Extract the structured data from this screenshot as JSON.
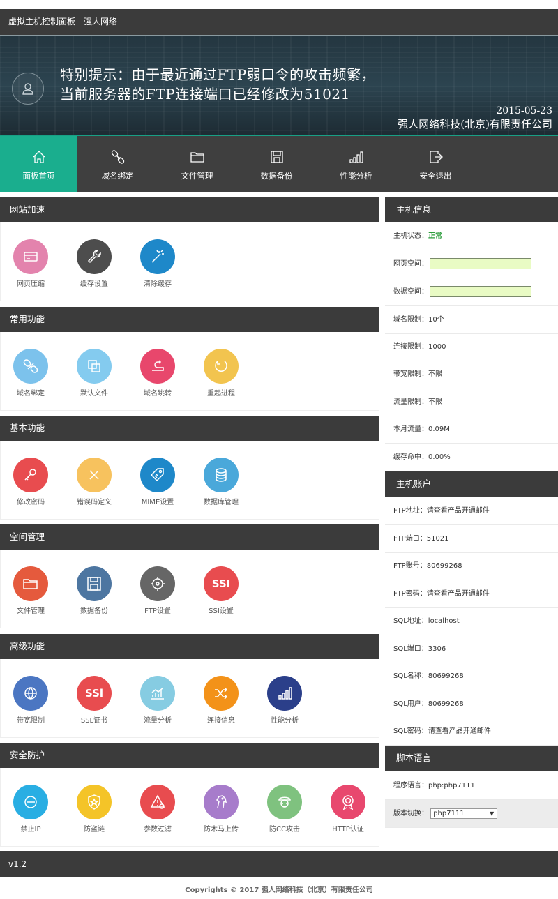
{
  "app": {
    "title": "虚拟主机控制面板 - 强人网络"
  },
  "banner": {
    "line1": "特别提示：由于最近通过FTP弱口令的攻击频繁，",
    "line2": "当前服务器的FTP连接端口已经修改为51021",
    "date": "2015-05-23",
    "company": "强人网络科技(北京)有限责任公司"
  },
  "nav": [
    {
      "label": "面板首页",
      "icon": "home-icon"
    },
    {
      "label": "域名绑定",
      "icon": "link-icon"
    },
    {
      "label": "文件管理",
      "icon": "folder-icon"
    },
    {
      "label": "数据备份",
      "icon": "floppy-icon"
    },
    {
      "label": "性能分析",
      "icon": "signal-icon"
    },
    {
      "label": "安全退出",
      "icon": "logout-icon"
    }
  ],
  "sections": [
    {
      "title": "网站加速",
      "items": [
        {
          "label": "网页压缩",
          "icon": "card-icon",
          "color": "#e383ad"
        },
        {
          "label": "缓存设置",
          "icon": "wrench-icon",
          "color": "#4d4d4d"
        },
        {
          "label": "清除缓存",
          "icon": "magic-wand-icon",
          "color": "#1e88c9"
        }
      ]
    },
    {
      "title": "常用功能",
      "items": [
        {
          "label": "域名绑定",
          "icon": "link-icon",
          "color": "#7cc2ec"
        },
        {
          "label": "默认文件",
          "icon": "copy-icon",
          "color": "#84cbef"
        },
        {
          "label": "域名跳转",
          "icon": "redirect-icon",
          "color": "#e8476c"
        },
        {
          "label": "重起进程",
          "icon": "refresh-icon",
          "color": "#f2c44f"
        }
      ]
    },
    {
      "title": "基本功能",
      "items": [
        {
          "label": "修改密码",
          "icon": "key-icon",
          "color": "#e84c4f"
        },
        {
          "label": "错误码定义",
          "icon": "cross-icon",
          "color": "#f7c25e"
        },
        {
          "label": "MIME设置",
          "icon": "tag-icon",
          "color": "#1e88c9"
        },
        {
          "label": "数据库管理",
          "icon": "database-icon",
          "color": "#4aa8da"
        }
      ]
    },
    {
      "title": "空间管理",
      "items": [
        {
          "label": "文件管理",
          "icon": "folder-icon",
          "color": "#e55a3d"
        },
        {
          "label": "数据备份",
          "icon": "floppy-icon",
          "color": "#4d76a1"
        },
        {
          "label": "FTP设置",
          "icon": "ftp-icon",
          "color": "#666666"
        },
        {
          "label": "SSI设置",
          "icon": "ssi-icon",
          "color": "#e84c4f"
        }
      ]
    },
    {
      "title": "高级功能",
      "items": [
        {
          "label": "带宽限制",
          "icon": "globe-icon",
          "color": "#4b76c2"
        },
        {
          "label": "SSL证书",
          "icon": "ssl-icon",
          "color": "#e84c4f"
        },
        {
          "label": "流量分析",
          "icon": "chart-icon",
          "color": "#86cce2"
        },
        {
          "label": "连接信息",
          "icon": "shuffle-icon",
          "color": "#f39219"
        },
        {
          "label": "性能分析",
          "icon": "signal-icon",
          "color": "#2b3f8a"
        }
      ]
    },
    {
      "title": "安全防护",
      "items": [
        {
          "label": "禁止IP",
          "icon": "ban-icon",
          "color": "#29aee3"
        },
        {
          "label": "防盗链",
          "icon": "shield-star-icon",
          "color": "#f4c428"
        },
        {
          "label": "参数过滤",
          "icon": "warning-icon",
          "color": "#e84c4f"
        },
        {
          "label": "防木马上传",
          "icon": "horse-icon",
          "color": "#a77ccb"
        },
        {
          "label": "防CC攻击",
          "icon": "pirate-icon",
          "color": "#7fc27f"
        },
        {
          "label": "HTTP认证",
          "icon": "badge-icon",
          "color": "#e8486e"
        }
      ]
    }
  ],
  "host_info": {
    "title": "主机信息",
    "status_label": "主机状态：",
    "status_value": "正常",
    "web_space_label": "网页空间：",
    "data_space_label": "数据空间：",
    "domain_limit": "域名限制：10个",
    "conn_limit": "连接限制：1000",
    "bandwidth_limit": "带宽限制：不限",
    "traffic_limit": "流量限制：不限",
    "month_traffic": "本月流量：0.09M",
    "cache_hit": "缓存命中：0.00%"
  },
  "host_account": {
    "title": "主机账户",
    "rows": [
      "FTP地址：请查看产品开通邮件",
      "FTP端口：51021",
      "FTP账号：80699268",
      "FTP密码：请查看产品开通邮件",
      "SQL地址：localhost",
      "SQL端口：3306",
      "SQL名称：80699268",
      "SQL用户：80699268",
      "SQL密码：请查看产品开通邮件"
    ]
  },
  "script_lang": {
    "title": "脚本语言",
    "program_lang": "程序语言：php:php7111",
    "switch_label": "版本切换：",
    "switch_value": "php7111"
  },
  "footer": {
    "version": "v1.2",
    "copyright": "Copyrights © 2017 强人网络科技（北京）有限责任公司"
  }
}
